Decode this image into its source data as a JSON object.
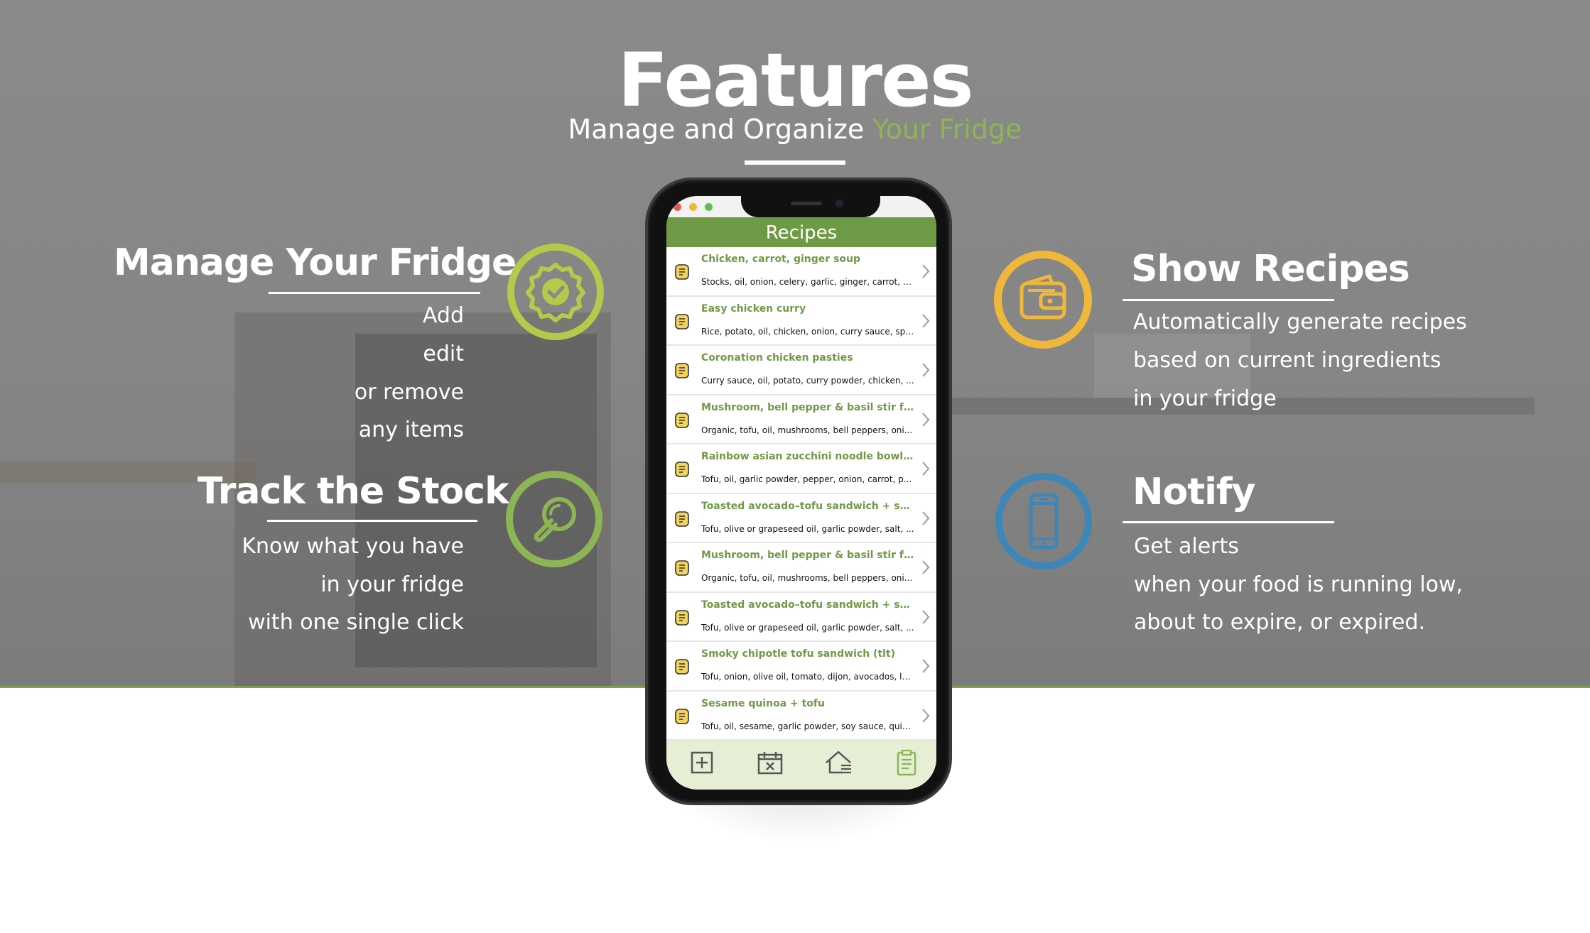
{
  "header": {
    "title": "Features",
    "subtitle_plain": "Manage and Organize ",
    "subtitle_accent": "Your Fridge"
  },
  "features": {
    "manage": {
      "heading_plain": "Manage ",
      "heading_underlined": "Your Fridge",
      "lines": [
        "Add",
        "edit",
        "or remove",
        "any items"
      ],
      "icon": "badge-check-icon",
      "color": "#b5c94a"
    },
    "track": {
      "heading": "Track the Stock",
      "lines": [
        "Know what you have",
        "in your fridge",
        "with one single click"
      ],
      "icon": "magnifier-icon",
      "color": "#8db553"
    },
    "recipes": {
      "heading": "Show Recipes",
      "lines": [
        "Automatically generate recipes",
        "based on current ingredients",
        "in your fridge"
      ],
      "icon": "wallet-icon",
      "color": "#f0b83a"
    },
    "notify": {
      "heading": "Notify",
      "lines": [
        "Get alerts",
        "when your food is running low,",
        "about to expire, or expired."
      ],
      "icon": "phone-icon",
      "color": "#3d86b8"
    }
  },
  "app": {
    "nav_title": "Recipes",
    "recipes": [
      {
        "title": "Chicken, carrot, ginger soup",
        "ingredients": "Stocks, oil, onion, celery, garlic, ginger, carrot, c..."
      },
      {
        "title": "Easy chicken curry",
        "ingredients": "Rice, potato, oil, chicken, onion, curry sauce, spi..."
      },
      {
        "title": "Coronation chicken pasties",
        "ingredients": "Curry sauce, oil, potato, curry powder, chicken, ..."
      },
      {
        "title": "Mushroom, bell pepper & basil stir fry",
        "ingredients": "Organic, tofu, oil, mushrooms, bell peppers, oni..."
      },
      {
        "title": "Rainbow asian zucchini noodle bowl ...",
        "ingredients": "Tofu, oil, garlic powder, pepper, onion, carrot, p..."
      },
      {
        "title": "Toasted avocado–tofu sandwich + sa...",
        "ingredients": "Tofu, olive or grapeseed oil, garlic powder, salt, ..."
      },
      {
        "title": "Mushroom, bell pepper & basil stir fry",
        "ingredients": "Organic, tofu, oil, mushrooms, bell peppers, oni..."
      },
      {
        "title": "Toasted avocado–tofu sandwich + sa...",
        "ingredients": "Tofu, olive or grapeseed oil, garlic powder, salt, ..."
      },
      {
        "title": "Smoky chipotle tofu sandwich (tlt)",
        "ingredients": "Tofu, onion, olive oil, tomato, dijon, avocados, le..."
      },
      {
        "title": "Sesame quinoa + tofu",
        "ingredients": "Tofu, oil, sesame, garlic powder, soy sauce, quin..."
      }
    ],
    "tabs": [
      "add-item-icon",
      "expired-calendar-icon",
      "home-list-icon",
      "clipboard-icon"
    ],
    "accent": "#6f9a45"
  }
}
